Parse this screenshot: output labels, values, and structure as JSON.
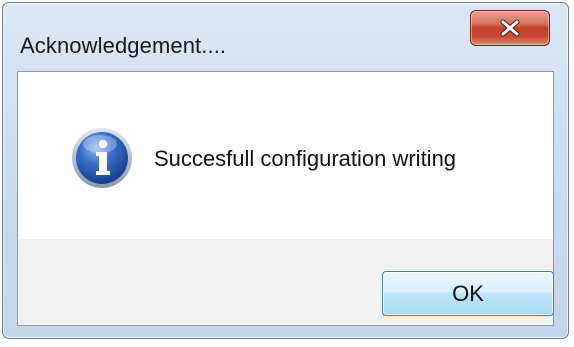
{
  "dialog": {
    "title": "Acknowledgement....",
    "message": "Succesfull configuration writing",
    "ok_label": "OK",
    "icon": "info-icon",
    "close_icon": "close-icon"
  },
  "colors": {
    "frame": "#cbdcf0",
    "close_button": "#c5412c",
    "ok_button": "#bee6fd",
    "info_icon": "#2b5fb8",
    "content_bg": "#ffffff",
    "footer_bg": "#f0f0f0"
  }
}
